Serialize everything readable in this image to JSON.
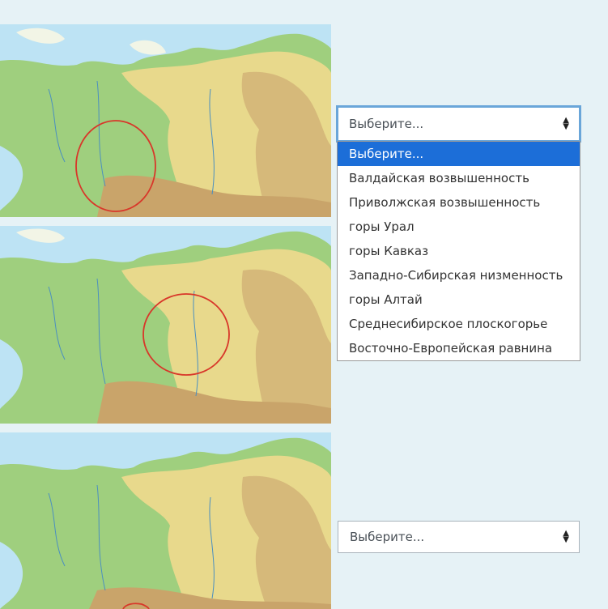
{
  "questions": [
    {
      "map_icon": "russia-physical-map",
      "highlight": "red-circle",
      "select": {
        "value": "Выберите...",
        "open": true
      }
    },
    {
      "map_icon": "russia-physical-map",
      "highlight": "red-circle"
    },
    {
      "map_icon": "russia-physical-map",
      "highlight": "red-circle",
      "select": {
        "value": "Выберите...",
        "open": false
      }
    }
  ],
  "dropdown": {
    "options": [
      "Выберите...",
      "Валдайская возвышенность",
      "Приволжская возвышенность",
      "горы Урал",
      "горы Кавказ",
      "Западно-Сибирская низменность",
      "горы Алтай",
      "Среднесибирское плоскогорье",
      "Восточно-Европейская равнина"
    ],
    "selected_index": 0
  },
  "colors": {
    "page_background": "#e6f2f6",
    "highlight_circle": "#d8372a",
    "focus_border": "#6aa6d9",
    "option_selected_bg": "#1c6ed8",
    "sea": "#bde3f4",
    "lowland": "#9fcf7e",
    "upland": "#e8d98c",
    "mountain": "#c9a46a"
  }
}
